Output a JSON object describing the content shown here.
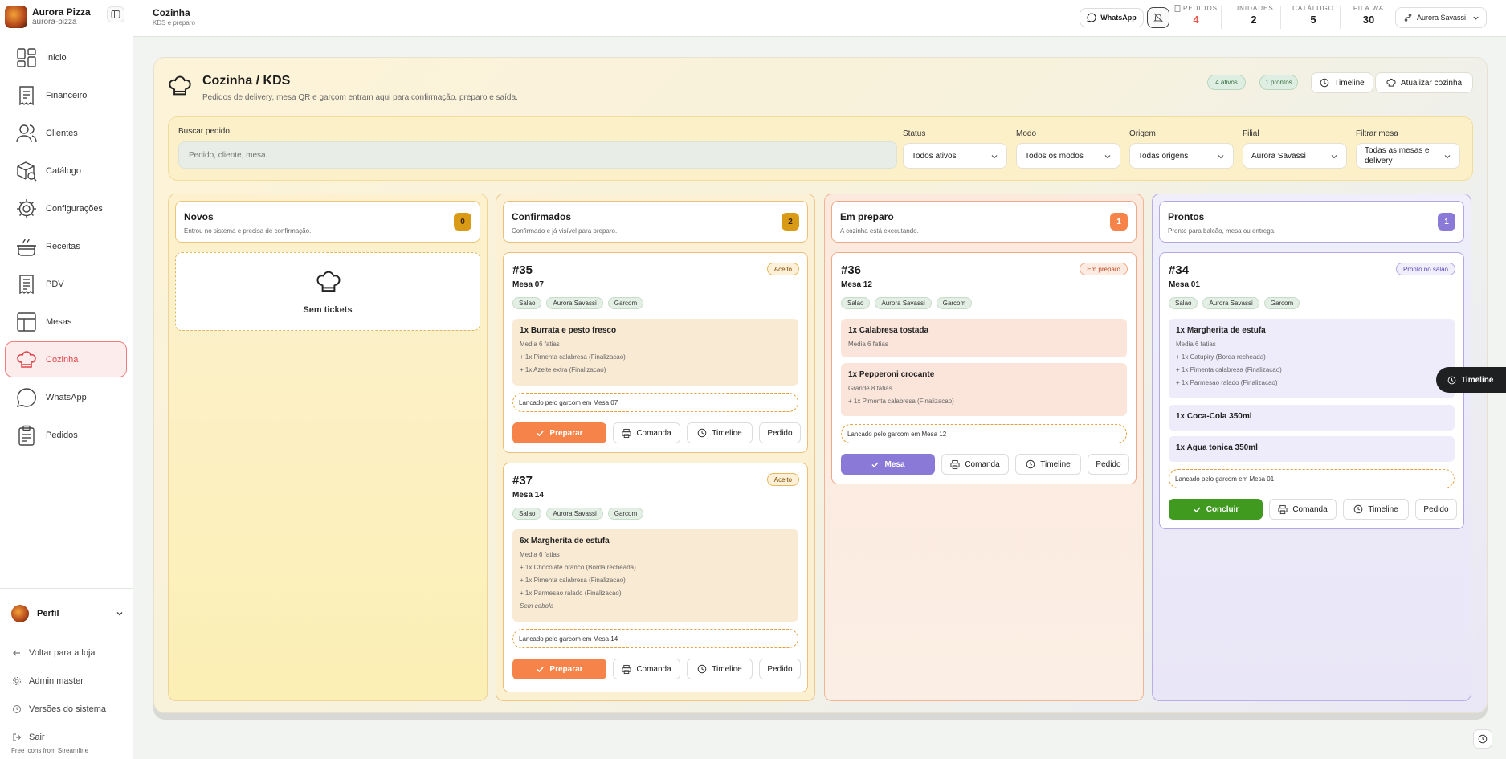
{
  "brand": {
    "name": "Aurora Pizza",
    "slug": "aurora-pizza"
  },
  "sidebar": {
    "items": [
      {
        "label": "Inicio",
        "icon": "dashboard-icon"
      },
      {
        "label": "Financeiro",
        "icon": "receipt-icon"
      },
      {
        "label": "Clientes",
        "icon": "users-icon"
      },
      {
        "label": "Catálogo",
        "icon": "box-search-icon"
      },
      {
        "label": "Configurações",
        "icon": "gear-icon"
      },
      {
        "label": "Receitas",
        "icon": "pot-icon"
      },
      {
        "label": "PDV",
        "icon": "pos-icon"
      },
      {
        "label": "Mesas",
        "icon": "table-icon"
      },
      {
        "label": "Cozinha",
        "icon": "chef-hat-icon",
        "active": true
      },
      {
        "label": "WhatsApp",
        "icon": "chat-icon"
      },
      {
        "label": "Pedidos",
        "icon": "clipboard-icon"
      }
    ],
    "profile": "Perfil",
    "links": [
      "Voltar para a loja",
      "Admin master",
      "Versões do sistema",
      "Sair"
    ],
    "credits": "Free icons from Streamline"
  },
  "topbar": {
    "title": "Cozinha",
    "subtitle": "KDS e preparo",
    "whatsapp_label": "WhatsApp",
    "stats": [
      {
        "key": "PEDIDOS",
        "value": "4",
        "color": "#e8594b"
      },
      {
        "key": "UNIDADES",
        "value": "2",
        "color": "#1b1b1b"
      },
      {
        "key": "CATÁLOGO",
        "value": "5",
        "color": "#1b1b1b"
      },
      {
        "key": "FILA WA",
        "value": "30",
        "color": "#1b1b1b"
      }
    ],
    "filial": "Aurora Savassi"
  },
  "page": {
    "title": "Cozinha / KDS",
    "subtitle": "Pedidos de delivery, mesa QR e garçom entram aqui para confirmação, preparo e saída.",
    "pill_active": "4 ativos",
    "pill_ready": "1 prontos",
    "timeline_label": "Timeline",
    "refresh_label": "Atualizar cozinha"
  },
  "filters": {
    "search_label": "Buscar pedido",
    "search_placeholder": "Pedido, cliente, mesa...",
    "selects": [
      {
        "label": "Status",
        "value": "Todos ativos"
      },
      {
        "label": "Modo",
        "value": "Todos os modos"
      },
      {
        "label": "Origem",
        "value": "Todas origens"
      },
      {
        "label": "Filial",
        "value": "Aurora Savassi"
      },
      {
        "label": "Filtrar mesa",
        "value": "Todas as mesas e delivery"
      }
    ]
  },
  "columns": [
    {
      "title": "Novos",
      "subtitle": "Entrou no sistema e precisa de confirmação.",
      "count": "0",
      "empty_text": "Sem tickets"
    },
    {
      "title": "Confirmados",
      "subtitle": "Confirmado e já visível para preparo.",
      "count": "2"
    },
    {
      "title": "Em preparo",
      "subtitle": "A cozinha está executando.",
      "count": "1"
    },
    {
      "title": "Prontos",
      "subtitle": "Pronto para balcão, mesa ou entrega.",
      "count": "1"
    }
  ],
  "tickets": {
    "t35": {
      "number": "#35",
      "table": "Mesa 07",
      "badge": "Aceito",
      "tags": [
        "Salao",
        "Aurora Savassi",
        "Garcom"
      ],
      "items": [
        {
          "name": "1x Burrata e pesto fresco",
          "details": [
            "Media 6 fatias",
            "+ 1x Pimenta calabresa (Finalizacao)",
            "+ 1x Azeite extra (Finalizacao)"
          ]
        }
      ],
      "note": "Lancado pelo garcom em Mesa 07",
      "action": "Preparar"
    },
    "t37": {
      "number": "#37",
      "table": "Mesa 14",
      "badge": "Aceito",
      "tags": [
        "Salao",
        "Aurora Savassi",
        "Garcom"
      ],
      "items": [
        {
          "name": "6x Margherita de estufa",
          "details": [
            "Media 6 fatias",
            "+ 1x Chocolate branco (Borda recheada)",
            "+ 1x Pimenta calabresa (Finalizacao)",
            "+ 1x Parmesao ralado (Finalizacao)"
          ],
          "obs": "Sem cebola"
        }
      ],
      "note": "Lancado pelo garcom em Mesa 14",
      "action": "Preparar"
    },
    "t36": {
      "number": "#36",
      "table": "Mesa 12",
      "badge": "Em preparo",
      "tags": [
        "Salao",
        "Aurora Savassi",
        "Garcom"
      ],
      "items": [
        {
          "name": "1x Calabresa tostada",
          "details": [
            "Media 6 fatias"
          ]
        },
        {
          "name": "1x Pepperoni crocante",
          "details": [
            "Grande 8 fatias",
            "+ 1x Pimenta calabresa (Finalizacao)"
          ]
        }
      ],
      "note": "Lancado pelo garcom em Mesa 12",
      "action": "Mesa"
    },
    "t34": {
      "number": "#34",
      "table": "Mesa 01",
      "badge": "Pronto no salão",
      "tags": [
        "Salao",
        "Aurora Savassi",
        "Garcom"
      ],
      "items": [
        {
          "name": "1x Margherita de estufa",
          "details": [
            "Media 6 fatias",
            "+ 1x Catupiry (Borda recheada)",
            "+ 1x Pimenta calabresa (Finalizacao)",
            "+ 1x Parmesao ralado (Finalizacao)"
          ]
        },
        {
          "name": "1x Coca-Cola 350ml",
          "details": []
        },
        {
          "name": "1x Agua tonica 350ml",
          "details": []
        }
      ],
      "note": "Lancado pelo garcom em Mesa 01",
      "action": "Concluir"
    }
  },
  "card_actions": {
    "comanda": "Comanda",
    "timeline": "Timeline",
    "pedido": "Pedido"
  },
  "float_timeline": "Timeline",
  "colors": {
    "accent": "#e0474c",
    "orange": "#f5834a",
    "purple": "#8b79d8",
    "green": "#3f9a1f",
    "amber": "#e0a21b"
  }
}
